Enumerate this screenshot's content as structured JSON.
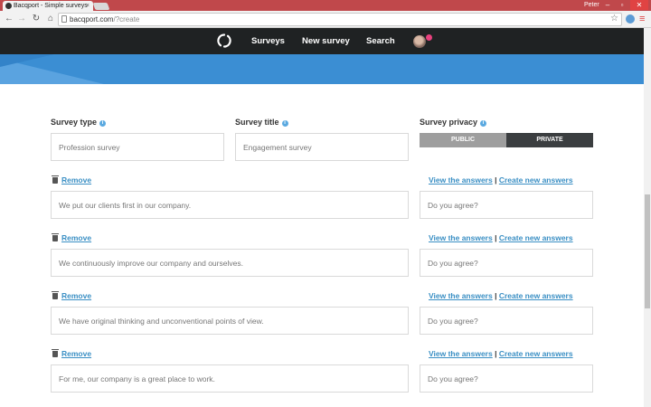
{
  "browser": {
    "tab_title": "Bacqport - Simple surveys",
    "tab_close": "×",
    "user": "Peter",
    "url_domain": "bacqport.com",
    "url_path": "/?create"
  },
  "nav": {
    "surveys": "Surveys",
    "new_survey": "New survey",
    "search": "Search"
  },
  "form": {
    "survey_type_label": "Survey type",
    "survey_type_value": "Profession survey",
    "survey_title_label": "Survey title",
    "survey_title_value": "Engagement survey",
    "privacy_label": "Survey privacy",
    "privacy_public": "PUBLIC",
    "privacy_private": "PRIVATE",
    "privacy_selected": "PRIVATE"
  },
  "questions": [
    {
      "remove": "Remove",
      "statement": "We put our clients first in our company.",
      "view": "View the answers",
      "sep": "|",
      "create": "Create new answers",
      "answer": "Do you agree?"
    },
    {
      "remove": "Remove",
      "statement": "We continuously improve our company and ourselves.",
      "view": "View the answers",
      "sep": "|",
      "create": "Create new answers",
      "answer": "Do you agree?"
    },
    {
      "remove": "Remove",
      "statement": "We have original thinking and unconventional points of view.",
      "view": "View the answers",
      "sep": "|",
      "create": "Create new answers",
      "answer": "Do you agree?"
    },
    {
      "remove": "Remove",
      "statement": "For me, our company is a great place to work.",
      "view": "View the answers",
      "sep": "|",
      "create": "Create new answers",
      "answer": "Do you agree?"
    }
  ],
  "colors": {
    "accent": "#3a8fc4",
    "nav_bg": "#1f2223",
    "banner": "#3b8ed3"
  }
}
